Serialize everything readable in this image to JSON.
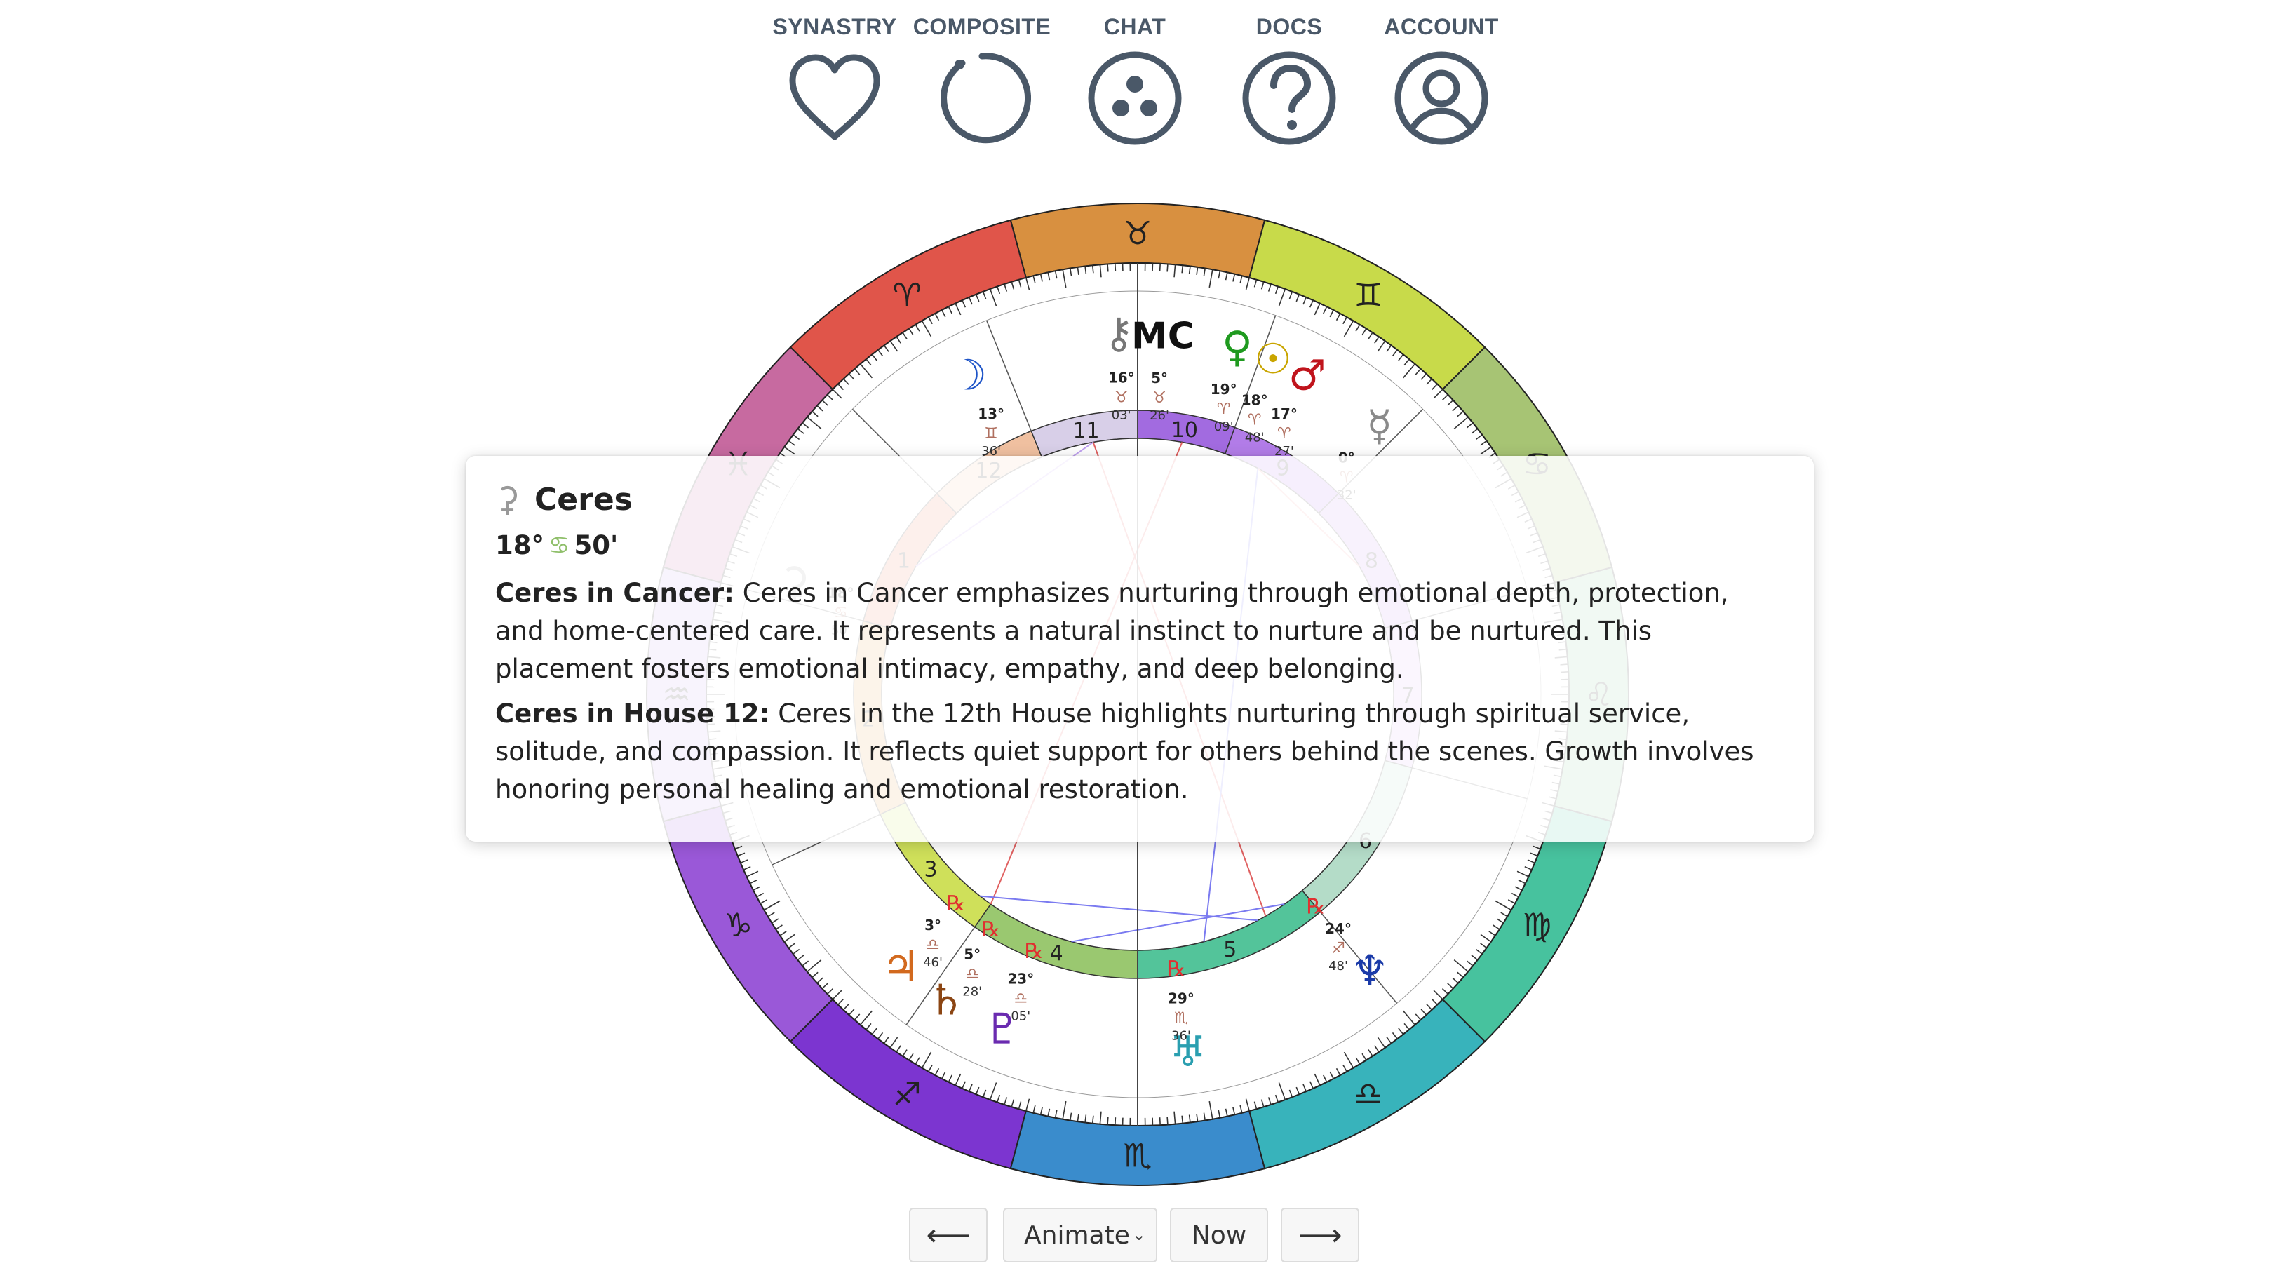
{
  "nav": {
    "items": [
      {
        "label": "SYNASTRY",
        "icon": "heart-icon"
      },
      {
        "label": "COMPOSITE",
        "icon": "circle-arc-icon"
      },
      {
        "label": "CHAT",
        "icon": "chat-dots-icon"
      },
      {
        "label": "DOCS",
        "icon": "question-icon"
      },
      {
        "label": "ACCOUNT",
        "icon": "user-circle-icon"
      }
    ],
    "color": "#4a5868"
  },
  "wheel": {
    "signs": [
      {
        "glyph": "♉",
        "color": "#d89040"
      },
      {
        "glyph": "♈",
        "color": "#e0554a"
      },
      {
        "glyph": "♓",
        "color": "#c76aa0"
      },
      {
        "glyph": "♒",
        "color": "#c6a4e8"
      },
      {
        "glyph": "♑",
        "color": "#9a58d8"
      },
      {
        "glyph": "♐",
        "color": "#7c35d0"
      },
      {
        "glyph": "♏",
        "color": "#3a8ccc"
      },
      {
        "glyph": "♎",
        "color": "#38b3bb"
      },
      {
        "glyph": "♍",
        "color": "#47c29e"
      },
      {
        "glyph": "♌",
        "color": "#8ccf98"
      },
      {
        "glyph": "♋",
        "color": "#a7c474"
      },
      {
        "glyph": "♊",
        "color": "#c8da4a"
      }
    ],
    "houses": [
      "10",
      "9",
      "8",
      "7",
      "6",
      "5",
      "4",
      "3",
      "2",
      "1",
      "12",
      "11"
    ],
    "planets": [
      {
        "name": "chiron",
        "glyph": "⚷",
        "deg": "16°",
        "sign": "♉",
        "min": "03'",
        "color": "#777777"
      },
      {
        "name": "mc",
        "glyph": "MC",
        "deg": "5°",
        "sign": "♉",
        "min": "26'",
        "color": "#111111"
      },
      {
        "name": "venus",
        "glyph": "♀",
        "deg": "19°",
        "sign": "♈",
        "min": "09'",
        "color": "#1f9a1f"
      },
      {
        "name": "sun",
        "glyph": "☉",
        "deg": "18°",
        "sign": "♈",
        "min": "48'",
        "color": "#c9a500"
      },
      {
        "name": "mars",
        "glyph": "♂",
        "deg": "17°",
        "sign": "♈",
        "min": "27'",
        "color": "#c0141c"
      },
      {
        "name": "mercury",
        "glyph": "☿",
        "deg": "0°",
        "sign": "♈",
        "min": "32'",
        "color": "#8a8a8a"
      },
      {
        "name": "moon",
        "glyph": "☽",
        "deg": "13°",
        "sign": "♊",
        "min": "36'",
        "color": "#1f55c8"
      },
      {
        "name": "ceres-wheel",
        "glyph": "⚳",
        "deg": "18°",
        "sign": "♋",
        "min": "50'",
        "color": "#999999"
      },
      {
        "name": "jupiter",
        "glyph": "♃",
        "deg": "3°",
        "sign": "♎",
        "min": "46'",
        "color": "#d2691e",
        "retro": "℞"
      },
      {
        "name": "saturn",
        "glyph": "♄",
        "deg": "5°",
        "sign": "♎",
        "min": "28'",
        "color": "#8b4513",
        "retro": "℞"
      },
      {
        "name": "pluto",
        "glyph": "♇",
        "deg": "23°",
        "sign": "♎",
        "min": "05'",
        "color": "#6a2bb0",
        "retro": "℞"
      },
      {
        "name": "uranus",
        "glyph": "♅",
        "deg": "29°",
        "sign": "♏",
        "min": "36'",
        "color": "#2a9fb0",
        "retro": "℞"
      },
      {
        "name": "neptune",
        "glyph": "♆",
        "deg": "24°",
        "sign": "♐",
        "min": "48'",
        "color": "#1a3aa8",
        "retro": "℞"
      }
    ]
  },
  "tooltip": {
    "glyph": "⚳",
    "title": "Ceres",
    "degree": "18°",
    "sign_glyph": "♋",
    "minutes": "50'",
    "sign_label": "Ceres in Cancer:",
    "sign_text": "Ceres in Cancer emphasizes nurturing through emotional depth, protection, and home-centered care. It represents a natural instinct to nurture and be nurtured. This placement fosters emotional intimacy, empathy, and deep belonging.",
    "house_label": "Ceres in House 12:",
    "house_text": "Ceres in the 12th House highlights nurturing through spiritual service, solitude, and compassion. It reflects quiet support for others behind the scenes. Growth involves honoring personal healing and emotional restoration."
  },
  "controls": {
    "prev": "⟵",
    "animate": "Animate",
    "now": "Now",
    "next": "⟶"
  }
}
